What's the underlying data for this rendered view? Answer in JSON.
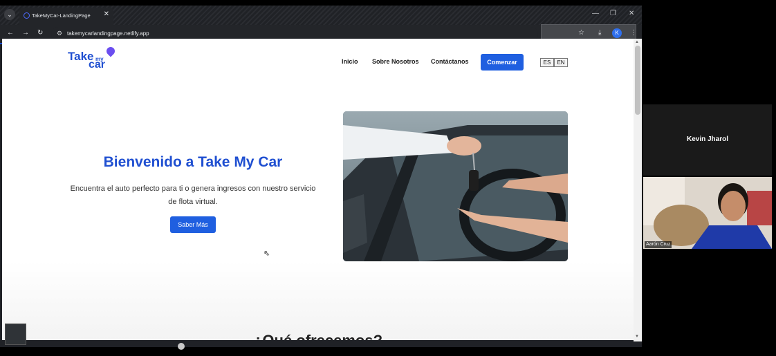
{
  "browser": {
    "tab_title": "TakeMyCar-LandingPage",
    "url": "takemycarlandingpage.netlify.app",
    "profile_initial": "K"
  },
  "site": {
    "logo": {
      "take": "Take",
      "my": "my",
      "car": "car"
    },
    "nav": {
      "inicio": "Inicio",
      "sobre": "Sobre Nosotros",
      "contacto": "Contáctanos",
      "comenzar": "Comenzar"
    },
    "lang": {
      "es": "ES",
      "en": "EN"
    },
    "hero": {
      "title": "Bienvenido a Take My Car",
      "subtitle": "Encuentra el auto perfecto para ti o genera ingresos con nuestro servicio de flota virtual.",
      "button": "Saber Más"
    },
    "section_title": "¿Qué ofrecemos?"
  },
  "meeting": {
    "speaker_name": "Kevin Jharol",
    "participant_label": "Aarón Cruz"
  },
  "colors": {
    "brand_blue": "#1f4fd1",
    "button_blue": "#1f5fe0"
  }
}
